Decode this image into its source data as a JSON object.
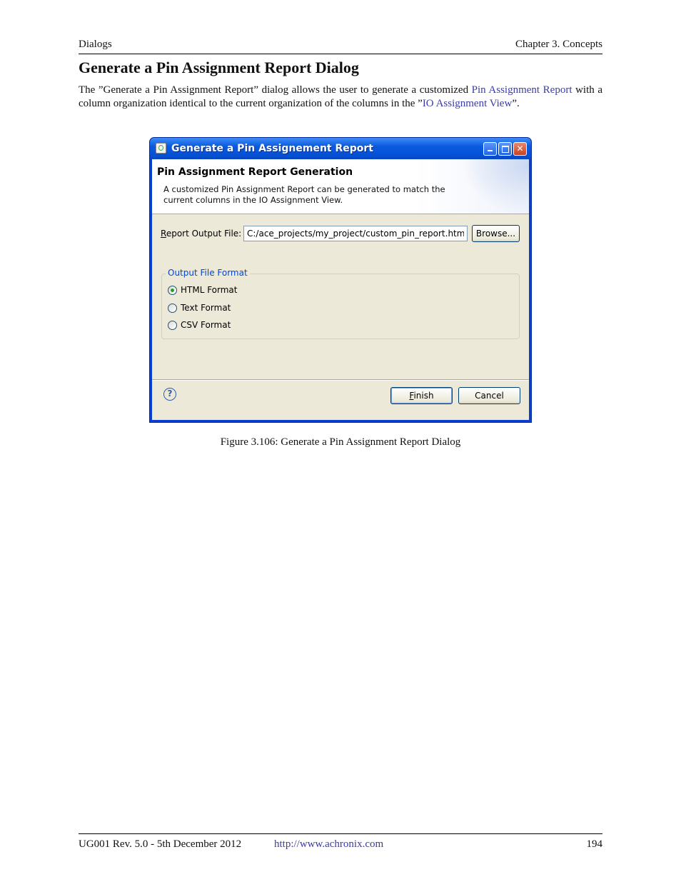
{
  "header": {
    "left": "Dialogs",
    "right": "Chapter 3. Concepts"
  },
  "section_title": "Generate a Pin Assignment Report Dialog",
  "intro": {
    "part1": "The ”Generate a Pin Assignment Report” dialog allows the user to generate a customized ",
    "link1": "Pin Assignment Report",
    "part2": " with a column organization identical to the current organization of the columns in the ”",
    "link2": "IO Assignment View",
    "part3": "”."
  },
  "dialog": {
    "title": "Generate a Pin Assignement Report",
    "banner_title": "Pin Assignment Report Generation",
    "banner_desc": "A customized Pin Assignment Report can be generated to match the current columns in the IO Assignment View.",
    "field_label_mnemonic": "R",
    "field_label_rest": "eport Output File:",
    "output_file_value": "C:/ace_projects/my_project/custom_pin_report.html",
    "browse_label": "Browse...",
    "group_label": "Output File Format",
    "formats": [
      {
        "label": "HTML Format",
        "selected": true
      },
      {
        "label": "Text Format",
        "selected": false
      },
      {
        "label": "CSV Format",
        "selected": false
      }
    ],
    "help_glyph": "?",
    "finish_mnemonic": "F",
    "finish_rest": "inish",
    "cancel_label": "Cancel"
  },
  "caption": "Figure 3.106: Generate a Pin Assignment Report Dialog",
  "footer": {
    "left": "UG001 Rev. 5.0 - 5th December 2012",
    "url": "http://www.achronix.com",
    "page": "194"
  },
  "colors": {
    "link": "#3b3ba8",
    "titlebar": "#0a5ae0",
    "dialog_bg": "#ece9d8",
    "group_label": "#0046d5",
    "radio_selected": "#21a121"
  }
}
